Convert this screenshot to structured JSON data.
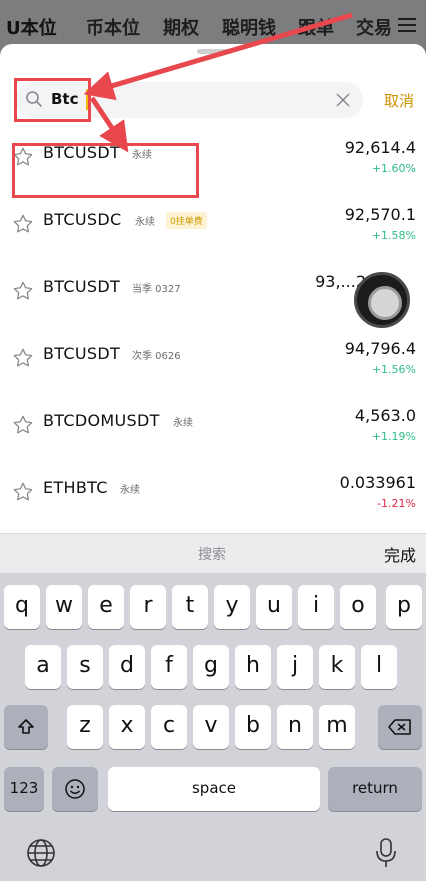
{
  "background_tabs": [
    "U本位",
    "币本位",
    "期权",
    "聪明钱",
    "跟单",
    "交易"
  ],
  "search": {
    "value": "Btc",
    "placeholder": ""
  },
  "cancel_label": "取消",
  "results": [
    {
      "symbol": "BTCUSDT",
      "tag": "永续",
      "fee_badge": "",
      "price": "92,614.4",
      "change": "+1.60%",
      "direction": "up"
    },
    {
      "symbol": "BTCUSDC",
      "tag": "永续",
      "fee_badge": "0挂单费",
      "price": "92,570.1",
      "change": "+1.58%",
      "direction": "up"
    },
    {
      "symbol": "BTCUSDT",
      "tag": "当季 0327",
      "fee_badge": "",
      "price": "93,...2",
      "change": "",
      "direction": "up"
    },
    {
      "symbol": "BTCUSDT",
      "tag": "次季 0626",
      "fee_badge": "",
      "price": "94,796.4",
      "change": "+1.56%",
      "direction": "up"
    },
    {
      "symbol": "BTCDOMUSDT",
      "tag": "永续",
      "fee_badge": "",
      "price": "4,563.0",
      "change": "+1.19%",
      "direction": "up"
    },
    {
      "symbol": "ETHBTC",
      "tag": "永续",
      "fee_badge": "",
      "price": "0.033961",
      "change": "-1.21%",
      "direction": "down"
    }
  ],
  "keyboard": {
    "toolbar_label": "搜索",
    "done_label": "完成",
    "row1": [
      "q",
      "w",
      "e",
      "r",
      "t",
      "y",
      "u",
      "i",
      "o",
      "p"
    ],
    "row2": [
      "a",
      "s",
      "d",
      "f",
      "g",
      "h",
      "j",
      "k",
      "l"
    ],
    "row3": [
      "z",
      "x",
      "c",
      "v",
      "b",
      "n",
      "m"
    ],
    "numbers_label": "123",
    "space_label": "space",
    "return_label": "return"
  },
  "colors": {
    "accent": "#f0b90b",
    "up": "#2ebd85",
    "down": "#e0294a",
    "annotation": "#e8474d"
  }
}
